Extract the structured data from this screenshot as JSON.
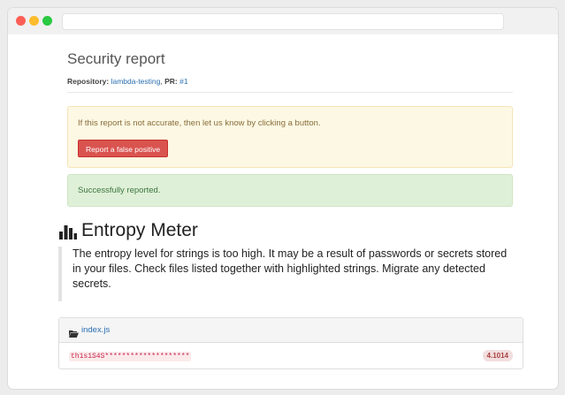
{
  "page": {
    "title": "Security report",
    "meta": {
      "repo_label": "Repository:",
      "repo_value": "lambda-testing",
      "pr_label": "PR:",
      "pr_value": "#1"
    }
  },
  "alerts": {
    "warning_text": "If this report is not accurate, then let us know by clicking a button.",
    "report_button": "Report a false positive",
    "success_text": "Successfully reported."
  },
  "section": {
    "icon": "bar-chart-icon",
    "title": "Entropy Meter",
    "description": "The entropy level for strings is too high. It may be a result of passwords or secrets stored in your files. Check files listed together with highlighted strings. Migrate any detected secrets."
  },
  "files": [
    {
      "icon": "folder-open-icon",
      "name": "index.js",
      "secret": "th1s1S4S********************",
      "entropy": "4.1014"
    }
  ],
  "colors": {
    "danger": "#d9534f",
    "warning_bg": "#fcf8e3",
    "success_bg": "#dff0d8",
    "link": "#2a6fb0"
  }
}
